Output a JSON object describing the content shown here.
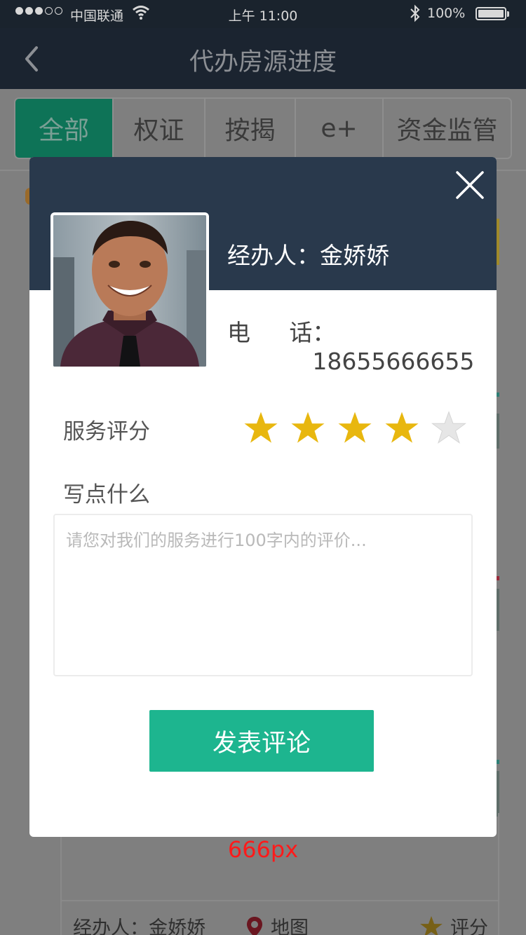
{
  "status_bar": {
    "carrier": "中国联通",
    "time": "上午 11:00",
    "battery": "100%"
  },
  "nav": {
    "title": "代办房源进度"
  },
  "tabs": [
    {
      "label": "全部",
      "active": true
    },
    {
      "label": "权证",
      "active": false
    },
    {
      "label": "按揭",
      "active": false
    },
    {
      "label": "e+",
      "active": false
    },
    {
      "label": "资金监管",
      "active": false
    }
  ],
  "modal": {
    "agent_label": "经办人：金娇娇",
    "phone_label_1": "电",
    "phone_label_2": "话",
    "phone_value": "：18655666655",
    "rating_label": "服务评分",
    "rating": 4,
    "rating_max": 5,
    "comment_label": "写点什么",
    "comment_placeholder": "请您对我们的服务进行100字内的评价...",
    "submit_label": "发表评论"
  },
  "background_card": {
    "agent": "经办人：金娇娇",
    "map_label": "地图",
    "rate_label": "评分"
  },
  "annotation": "666px",
  "colors": {
    "header_dark": "#29394c",
    "accent_green": "#1db58f",
    "star_gold": "#e8b70f",
    "star_empty": "#e6e6e6",
    "annotation_red": "#ff1a1a"
  }
}
